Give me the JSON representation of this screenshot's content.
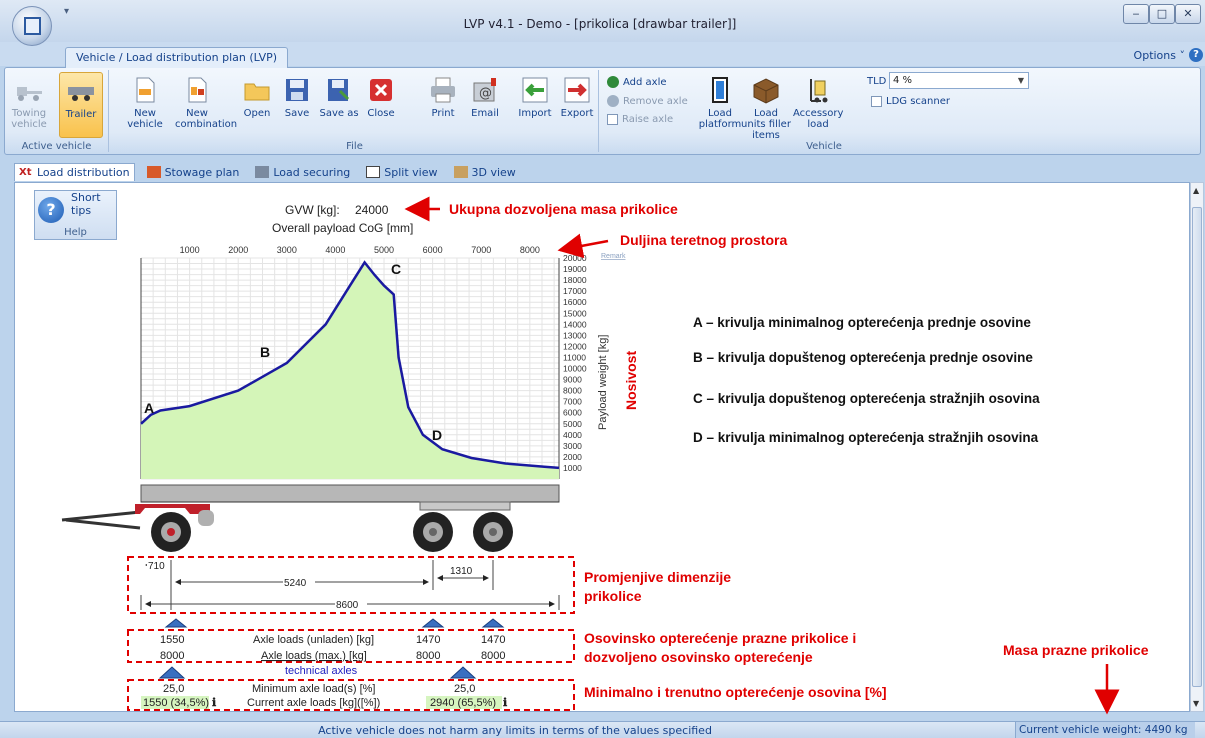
{
  "window": {
    "title": "LVP v4.1 - Demo - [prikolica [drawbar trailer]]",
    "qat": "▾",
    "ribbon_tab": "Vehicle / Load distribution plan (LVP)",
    "options": "Options ˅",
    "help_glyph": "?",
    "min": "‒",
    "max": "□",
    "close": "✕"
  },
  "ribbon": {
    "active_vehicle": {
      "label": "Active vehicle",
      "towing": "Towing vehicle",
      "trailer": "Trailer"
    },
    "file": {
      "label": "File",
      "new_vehicle": "New vehicle",
      "new_combination": "New combination",
      "open": "Open",
      "save": "Save",
      "save_as": "Save as",
      "close": "Close",
      "print": "Print",
      "email": "Email",
      "import": "Import",
      "export": "Export"
    },
    "vehicle": {
      "label": "Vehicle",
      "add_axle": "Add axle",
      "remove_axle": "Remove axle",
      "raise_axle": "Raise axle",
      "load_platform": "Load platform",
      "load_units": "Load units filler items",
      "accessory_load": "Accessory load",
      "tld_label": "TLD",
      "tld_value": "4 %",
      "ldg_scanner": "LDG scanner"
    }
  },
  "view_tabs": [
    "Load distribution",
    "Stowage plan",
    "Load securing",
    "Split view",
    "3D view"
  ],
  "help_panel": {
    "short_tips": "Short tips",
    "label": "Help"
  },
  "chart_data": {
    "type": "area",
    "title": "GVW [kg]:",
    "gvw_value": "24000",
    "subtitle": "Overall payload CoG [mm]",
    "ylabel": "Payload weight [kg]",
    "x_ticks": [
      1000,
      2000,
      3000,
      4000,
      5000,
      6000,
      7000,
      8000
    ],
    "y_ticks": [
      1000,
      2000,
      3000,
      4000,
      5000,
      6000,
      7000,
      8000,
      9000,
      10000,
      11000,
      12000,
      13000,
      14000,
      15000,
      16000,
      17000,
      18000,
      19000,
      20000
    ],
    "xlim": [
      0,
      8600
    ],
    "ylim": [
      0,
      20000
    ],
    "grid": true,
    "curve_labels": [
      "A",
      "B",
      "C",
      "D"
    ],
    "x": [
      0,
      200,
      400,
      1000,
      2000,
      3000,
      3800,
      4300,
      4600,
      4800,
      5000,
      5200,
      5300,
      5500,
      5800,
      6200,
      6800,
      7500,
      8300,
      8600
    ],
    "y": [
      5000,
      5800,
      6200,
      6600,
      8000,
      10500,
      14000,
      17500,
      19600,
      18500,
      17500,
      16700,
      11000,
      6500,
      4000,
      2700,
      1900,
      1400,
      1100,
      1000
    ]
  },
  "annotations": {
    "gvw": "Ukupna dozvoljena masa prikolice",
    "length": "Duljina teretnog prostora",
    "nosivost": "Nosivost",
    "curve_a": "A – krivulja minimalnog opterećenja prednje osovine",
    "curve_b": "B – krivulja dopuštenog opterećenja prednje osovine",
    "curve_c": "C – krivulja dopuštenog opterećenja stražnjih osovina",
    "curve_d": "D – krivulja minimalnog opterećenja stražnjih osovina",
    "dims_line1": "Promjenjive dimenzije",
    "dims_line2": "prikolice",
    "axle_line1": "Osovinsko opterećenje prazne prikolice i",
    "axle_line2": "dozvoljeno osovinsko opterećenje",
    "min_axle": "Minimalno  i trenutno opterećenje osovina [%]",
    "empty_mass": "Masa prazne prikolice",
    "remark": "Remark"
  },
  "dimensions": {
    "front": "710",
    "wheelbase": "5240",
    "rear_spacing": "1310",
    "total": "8600"
  },
  "axle_table": {
    "unladen_label": "Axle loads (unladen) [kg]",
    "max_label": "Axle loads (max.) [kg]",
    "technical_axles": "technical axles",
    "min_label": "Minimum axle load(s) [%]",
    "current_label": "Current axle loads [kg]([%])",
    "front_unladen": "1550",
    "front_max": "8000",
    "rear1_unladen": "1470",
    "rear1_max": "8000",
    "rear2_unladen": "1470",
    "rear2_max": "8000",
    "front_min": "25,0",
    "rear_min": "25,0",
    "front_current": "1550 (34,5%)",
    "rear_current": "2940 (65,5%)",
    "info_glyph": "ℹ"
  },
  "status": {
    "message": "Active vehicle does not harm any limits in terms of the values specified",
    "weight": "Current vehicle weight: 4490 kg"
  },
  "colors": {
    "accent": "#e00000",
    "curve": "#1a1aa0",
    "fill": "#d4f5b8"
  }
}
